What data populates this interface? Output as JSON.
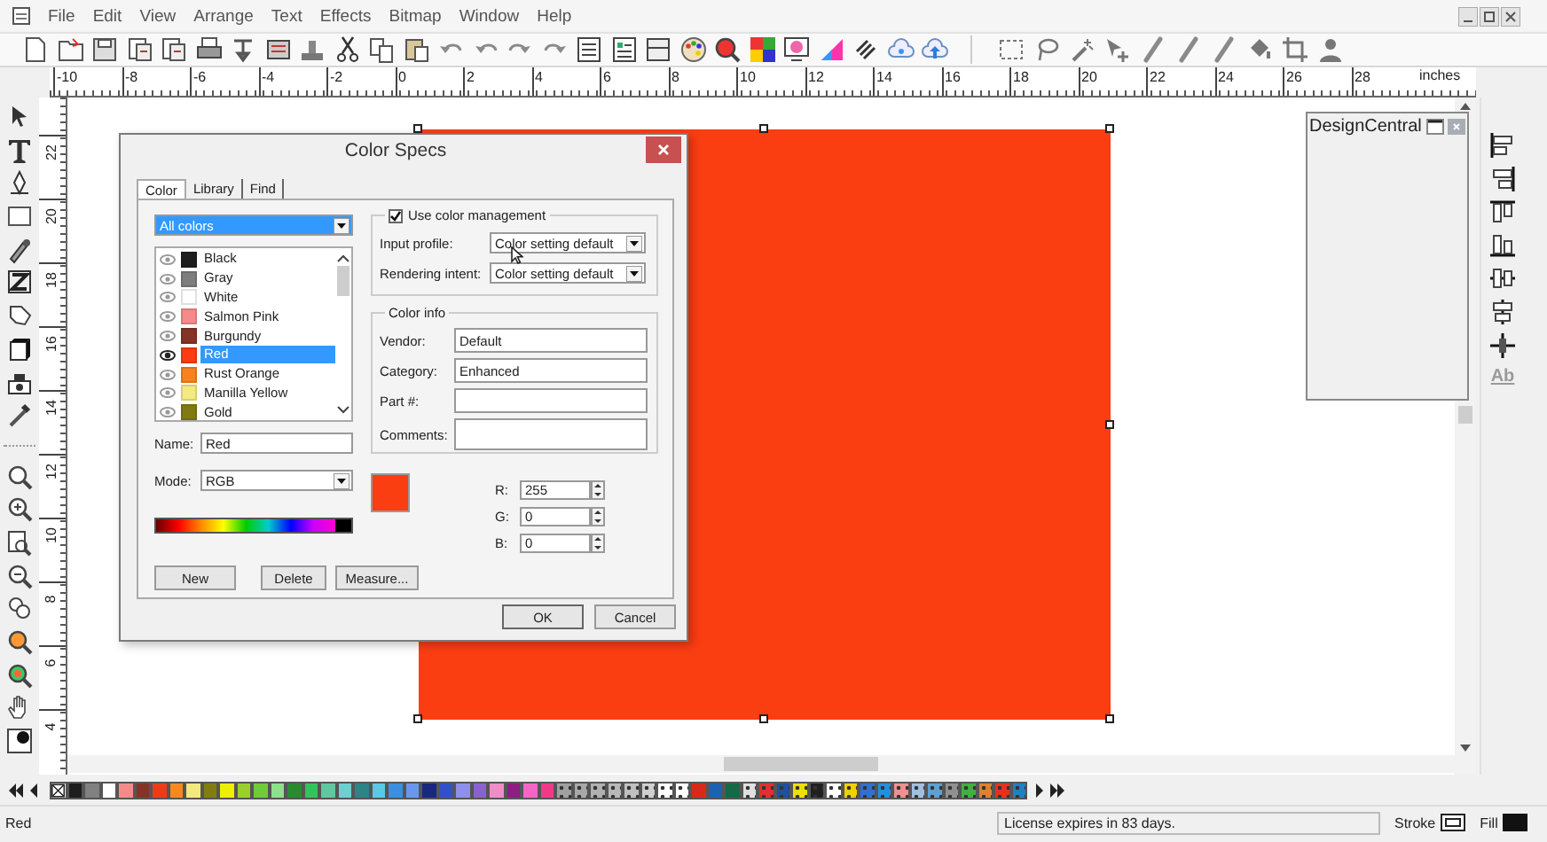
{
  "menu": [
    "File",
    "Edit",
    "View",
    "Arrange",
    "Text",
    "Effects",
    "Bitmap",
    "Window",
    "Help"
  ],
  "hruler": {
    "labels": [
      "-10",
      "-8",
      "-6",
      "-4",
      "-2",
      "0",
      "2",
      "4",
      "6",
      "8",
      "10",
      "12",
      "14",
      "16",
      "18",
      "20",
      "22",
      "24",
      "26",
      "28"
    ],
    "unit": "inches"
  },
  "vruler": {
    "labels": [
      "22",
      "20",
      "18",
      "16",
      "14",
      "12",
      "10",
      "8",
      "6",
      "4"
    ]
  },
  "canvas": {
    "objects": [
      {
        "kind": "rectangle",
        "color": "#fb3d12",
        "selected": true
      }
    ]
  },
  "dialog": {
    "title": "Color Specs",
    "tabs": [
      {
        "label": "Color",
        "selected": true
      },
      {
        "label": "Library",
        "selected": false
      },
      {
        "label": "Find",
        "selected": false
      }
    ],
    "filter": "All colors",
    "colors": [
      {
        "name": "Black",
        "color": "#1e1e1e",
        "selected": false
      },
      {
        "name": "Gray",
        "color": "#7d7d7d",
        "selected": false
      },
      {
        "name": "White",
        "color": "#ffffff",
        "selected": false
      },
      {
        "name": "Salmon Pink",
        "color": "#f48a8a",
        "selected": false
      },
      {
        "name": "Burgundy",
        "color": "#843427",
        "selected": false
      },
      {
        "name": "Red",
        "color": "#fb3d12",
        "selected": true
      },
      {
        "name": "Rust Orange",
        "color": "#f7821e",
        "selected": false
      },
      {
        "name": "Manilla Yellow",
        "color": "#f4ea82",
        "selected": false
      },
      {
        "name": "Gold",
        "color": "#827a10",
        "selected": false
      }
    ],
    "name_field": {
      "label": "Name:",
      "value": "Red"
    },
    "mode": {
      "label": "Mode:",
      "value": "RGB"
    },
    "buttons": [
      "New",
      "Delete",
      "Measure..."
    ],
    "color_management": {
      "label": "Use color management",
      "checked": true
    },
    "input_profile": {
      "label": "Input profile:",
      "value": "Color setting default"
    },
    "rendering_intent": {
      "label": "Rendering intent:",
      "value": "Color setting default"
    },
    "color_info": {
      "title": "Color info",
      "fields": [
        {
          "label": "Vendor:",
          "value": "Default"
        },
        {
          "label": "Category:",
          "value": "Enhanced"
        },
        {
          "label": "Part #:"
        },
        {
          "label": "Comments:"
        }
      ]
    },
    "rgb": [
      {
        "label": "R:",
        "value": "255"
      },
      {
        "label": "G:",
        "value": "0"
      },
      {
        "label": "B:",
        "value": "0"
      }
    ],
    "footer_buttons": [
      "OK",
      "Cancel"
    ]
  },
  "panel": {
    "title": "DesignCentral"
  },
  "right_toolbar": {
    "text_icon": "Ab"
  },
  "palette": [
    {
      "kind": "none"
    },
    {
      "kind": "solid",
      "color": "#1e1e1e"
    },
    {
      "kind": "solid",
      "color": "#808080"
    },
    {
      "kind": "solid",
      "color": "#ffffff"
    },
    {
      "kind": "solid",
      "color": "#f48a8a"
    },
    {
      "kind": "solid",
      "color": "#843427"
    },
    {
      "kind": "solid",
      "color": "#ef3a1a"
    },
    {
      "kind": "solid",
      "color": "#f7891e"
    },
    {
      "kind": "solid",
      "color": "#f4e97c"
    },
    {
      "kind": "solid",
      "color": "#827d12"
    },
    {
      "kind": "solid",
      "color": "#eef000"
    },
    {
      "kind": "solid",
      "color": "#9ad02c"
    },
    {
      "kind": "solid",
      "color": "#6fcb3a"
    },
    {
      "kind": "solid",
      "color": "#8fe08a"
    },
    {
      "kind": "solid",
      "color": "#2a8a2e"
    },
    {
      "kind": "solid",
      "color": "#34c35a"
    },
    {
      "kind": "solid",
      "color": "#60c7a0"
    },
    {
      "kind": "solid",
      "color": "#6ccfd0"
    },
    {
      "kind": "solid",
      "color": "#2c8486"
    },
    {
      "kind": "solid",
      "color": "#5bc8e8"
    },
    {
      "kind": "solid",
      "color": "#3a8fe0"
    },
    {
      "kind": "solid",
      "color": "#6a96ee"
    },
    {
      "kind": "solid",
      "color": "#17287e"
    },
    {
      "kind": "solid",
      "color": "#3151c8"
    },
    {
      "kind": "solid",
      "color": "#8f8fee"
    },
    {
      "kind": "solid",
      "color": "#8962d0"
    },
    {
      "kind": "solid",
      "color": "#f08cc8"
    },
    {
      "kind": "solid",
      "color": "#8c1e84"
    },
    {
      "kind": "solid",
      "color": "#f565c8"
    },
    {
      "kind": "solid",
      "color": "#f03a88"
    },
    {
      "kind": "pattern",
      "color": "#a0a0a0"
    },
    {
      "kind": "pattern",
      "color": "#a8a8a8"
    },
    {
      "kind": "pattern",
      "color": "#b0b0b0"
    },
    {
      "kind": "pattern",
      "color": "#b8b8b8"
    },
    {
      "kind": "pattern",
      "color": "#c0c0c0"
    },
    {
      "kind": "pattern",
      "color": "#d0d0d0"
    },
    {
      "kind": "pattern",
      "color": "#ffffff"
    },
    {
      "kind": "pattern",
      "color": "#ffffff"
    },
    {
      "kind": "solid",
      "color": "#d82a1a"
    },
    {
      "kind": "solid",
      "color": "#1d62b0"
    },
    {
      "kind": "solid",
      "color": "#146a46"
    },
    {
      "kind": "pattern",
      "color": "#e0e0e0"
    },
    {
      "kind": "pattern",
      "color": "#e03030"
    },
    {
      "kind": "pattern",
      "color": "#2050a0"
    },
    {
      "kind": "pattern",
      "color": "#f0e000"
    },
    {
      "kind": "pattern",
      "color": "#202020"
    },
    {
      "kind": "pattern",
      "color": "#ffffff"
    },
    {
      "kind": "pattern",
      "color": "#f0d000"
    },
    {
      "kind": "pattern",
      "color": "#3070d0"
    },
    {
      "kind": "pattern",
      "color": "#2090e0"
    },
    {
      "kind": "pattern",
      "color": "#f09090"
    },
    {
      "kind": "pattern",
      "color": "#a0c0e0"
    },
    {
      "kind": "pattern",
      "color": "#60a0d0"
    },
    {
      "kind": "pattern",
      "color": "#909090"
    },
    {
      "kind": "pattern",
      "color": "#40b040"
    },
    {
      "kind": "pattern",
      "color": "#e08030"
    },
    {
      "kind": "pattern",
      "color": "#e83020"
    },
    {
      "kind": "pattern",
      "color": "#2080c0"
    }
  ],
  "status": {
    "object": "Red",
    "license": "License expires in 83 days.",
    "stroke": "Stroke",
    "fill": "Fill"
  }
}
